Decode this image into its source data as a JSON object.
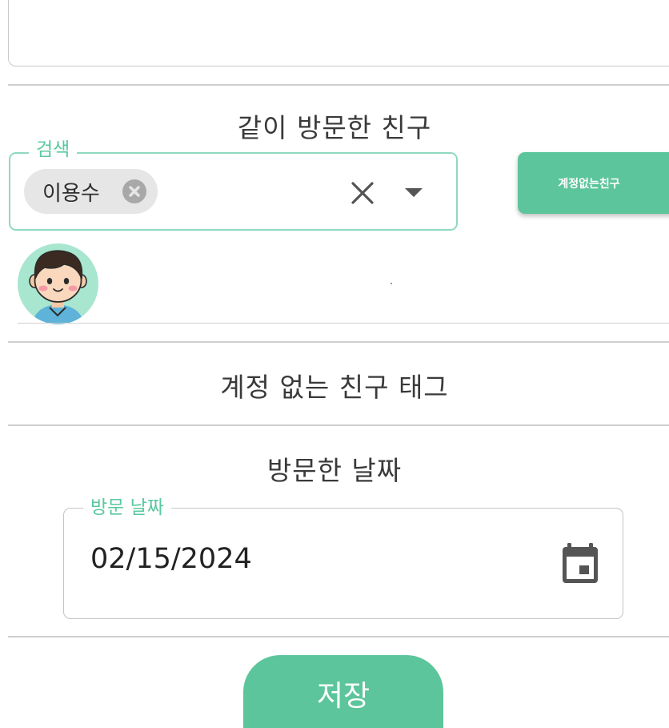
{
  "friends_section": {
    "title": "같이 방문한 친구",
    "search_label": "검색",
    "selected_chip": "이용수",
    "no_account_button": "계정없는친구"
  },
  "tag_section": {
    "title": "계정 없는 친구 태그"
  },
  "date_section": {
    "title": "방문한 날짜",
    "field_label": "방문 날짜",
    "value": "02/15/2024"
  },
  "save_button": "저장",
  "colors": {
    "accent": "#5cc59c",
    "accent_light": "#8fd9bf",
    "avatar_bg": "#a8e6cf"
  }
}
